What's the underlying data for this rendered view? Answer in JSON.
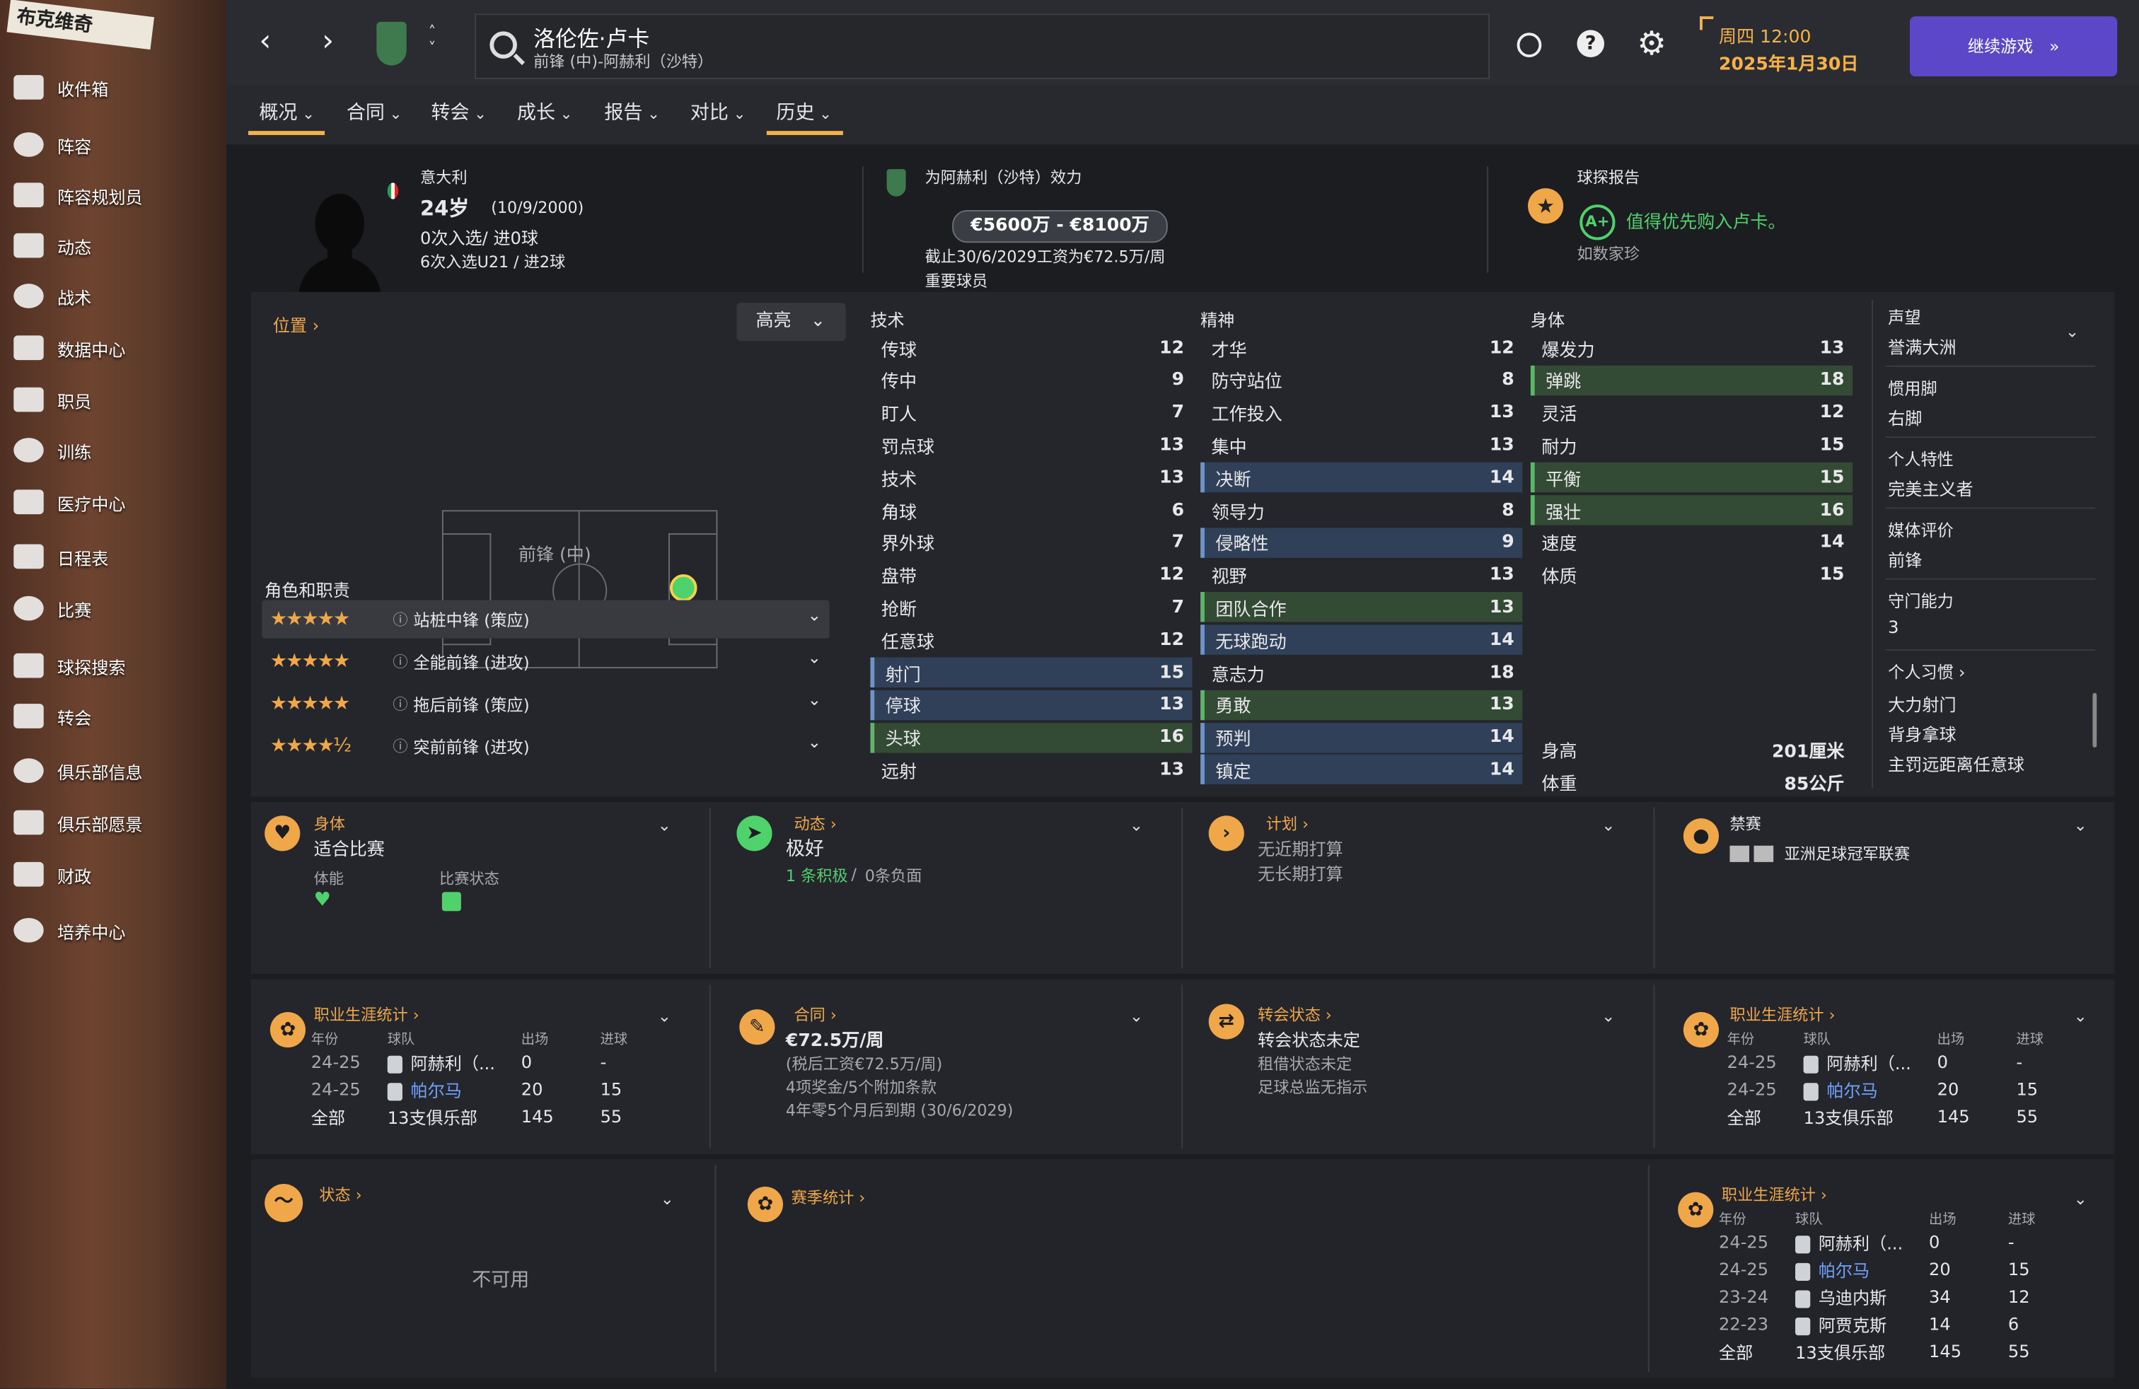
{
  "sidebar": {
    "brand": "布克维奇",
    "items": [
      "收件箱",
      "阵容",
      "阵容规划员",
      "动态",
      "战术",
      "数据中心",
      "职员",
      "训练",
      "医疗中心",
      "日程表",
      "比赛",
      "球探搜索",
      "转会",
      "俱乐部信息",
      "俱乐部愿景",
      "财政",
      "培养中心"
    ]
  },
  "header": {
    "player_name": "洛伦佐·卢卡",
    "player_sub": "前锋 (中)-阿赫利（沙特）",
    "help": "?",
    "day_time": "周四 12:00",
    "date": "2025年1月30日",
    "continue_label": "继续游戏"
  },
  "tabs": [
    "概况",
    "合同",
    "转会",
    "成长",
    "报告",
    "对比",
    "历史"
  ],
  "overview": {
    "nationality": "意大利",
    "age": "24岁",
    "dob": "(10/9/2000)",
    "caps": "0次入选/ 进0球",
    "u21": "6次入选U21 / 进2球",
    "club_line": "为阿赫利（沙特）效力",
    "value": "€5600万 - €8100万",
    "contract": "截止30/6/2029工资为€72.5万/周",
    "status": "重要球员",
    "scout_title": "球探报告",
    "grade": "A+",
    "scout_text": "值得优先购入卢卡。",
    "scout_name": "如数家珍"
  },
  "position_panel": {
    "title": "位置",
    "dropdown": "高亮",
    "position_label": "前锋 (中)",
    "roles_title": "角色和职责",
    "roles": [
      {
        "stars": "★★★★★",
        "name": "站桩中锋 (策应)"
      },
      {
        "stars": "★★★★★",
        "name": "全能前锋 (进攻)"
      },
      {
        "stars": "★★★★★",
        "name": "拖后前锋 (策应)"
      },
      {
        "stars": "★★★★½",
        "name": "突前前锋 (进攻)"
      }
    ]
  },
  "attributes": {
    "technical_title": "技术",
    "mental_title": "精神",
    "physical_title": "身体",
    "technical": [
      {
        "name": "传球",
        "value": "12",
        "hl": ""
      },
      {
        "name": "传中",
        "value": "9",
        "hl": ""
      },
      {
        "name": "盯人",
        "value": "7",
        "hl": ""
      },
      {
        "name": "罚点球",
        "value": "13",
        "hl": ""
      },
      {
        "name": "技术",
        "value": "13",
        "hl": ""
      },
      {
        "name": "角球",
        "value": "6",
        "hl": ""
      },
      {
        "name": "界外球",
        "value": "7",
        "hl": ""
      },
      {
        "name": "盘带",
        "value": "12",
        "hl": ""
      },
      {
        "name": "抢断",
        "value": "7",
        "hl": ""
      },
      {
        "name": "任意球",
        "value": "12",
        "hl": ""
      },
      {
        "name": "射门",
        "value": "15",
        "hl": "blue"
      },
      {
        "name": "停球",
        "value": "13",
        "hl": "blue"
      },
      {
        "name": "头球",
        "value": "16",
        "hl": "green"
      },
      {
        "name": "远射",
        "value": "13",
        "hl": ""
      }
    ],
    "mental": [
      {
        "name": "才华",
        "value": "12",
        "hl": ""
      },
      {
        "name": "防守站位",
        "value": "8",
        "hl": ""
      },
      {
        "name": "工作投入",
        "value": "13",
        "hl": ""
      },
      {
        "name": "集中",
        "value": "13",
        "hl": ""
      },
      {
        "name": "决断",
        "value": "14",
        "hl": "blue"
      },
      {
        "name": "领导力",
        "value": "8",
        "hl": ""
      },
      {
        "name": "侵略性",
        "value": "9",
        "hl": "blue"
      },
      {
        "name": "视野",
        "value": "13",
        "hl": ""
      },
      {
        "name": "团队合作",
        "value": "13",
        "hl": "green"
      },
      {
        "name": "无球跑动",
        "value": "14",
        "hl": "blue"
      },
      {
        "name": "意志力",
        "value": "18",
        "hl": ""
      },
      {
        "name": "勇敢",
        "value": "13",
        "hl": "green"
      },
      {
        "name": "预判",
        "value": "14",
        "hl": "blue"
      },
      {
        "name": "镇定",
        "value": "14",
        "hl": "blue"
      }
    ],
    "physical": [
      {
        "name": "爆发力",
        "value": "13",
        "hl": ""
      },
      {
        "name": "弹跳",
        "value": "18",
        "hl": "green"
      },
      {
        "name": "灵活",
        "value": "12",
        "hl": ""
      },
      {
        "name": "耐力",
        "value": "15",
        "hl": ""
      },
      {
        "name": "平衡",
        "value": "15",
        "hl": "green"
      },
      {
        "name": "强壮",
        "value": "16",
        "hl": "green"
      },
      {
        "name": "速度",
        "value": "14",
        "hl": ""
      },
      {
        "name": "体质",
        "value": "15",
        "hl": ""
      }
    ],
    "height_label": "身高",
    "height": "201厘米",
    "weight_label": "体重",
    "weight": "85公斤"
  },
  "info_side": [
    {
      "label": "声望",
      "value": "誉满大洲"
    },
    {
      "label": "惯用脚",
      "value": "右脚"
    },
    {
      "label": "个人特性",
      "value": "完美主义者"
    },
    {
      "label": "媒体评价",
      "value": "前锋"
    },
    {
      "label": "守门能力",
      "value": "3"
    }
  ],
  "habits": {
    "title": "个人习惯",
    "items": [
      "大力射门",
      "背身拿球",
      "主罚远距离任意球"
    ]
  },
  "cards1": {
    "fitness_title": "身体",
    "fitness_value": "适合比赛",
    "stamina_label": "体能",
    "match_label": "比赛状态",
    "dyn_title": "动态",
    "dyn_value": "极好",
    "dyn_positive": "1 条积极",
    "dyn_sep": "/",
    "dyn_negative": "0条负面",
    "plan_title": "计划",
    "plan_short": "无近期打算",
    "plan_long": "无长期打算",
    "ban_title": "禁赛",
    "ban_text": "亚洲足球冠军联赛"
  },
  "career": {
    "title": "职业生涯统计",
    "head": [
      "年份",
      "球队",
      "出场",
      "进球"
    ],
    "rows": [
      [
        "24-25",
        "阿赫利（...",
        "0",
        "-"
      ],
      [
        "24-25",
        "帕尔马",
        "20",
        "15"
      ]
    ],
    "rows_long": [
      [
        "24-25",
        "阿赫利（...",
        "0",
        "-"
      ],
      [
        "24-25",
        "帕尔马",
        "20",
        "15"
      ],
      [
        "23-24",
        "乌迪内斯",
        "34",
        "12"
      ],
      [
        "22-23",
        "阿贾克斯",
        "14",
        "6"
      ]
    ],
    "total": [
      "全部",
      "13支俱乐部",
      "145",
      "55"
    ]
  },
  "contract_card": {
    "title": "合同",
    "wage": "€72.5万/周",
    "pre_tax": "(税后工资€72.5万/周)",
    "bonus": "4项奖金/5个附加条款",
    "expiry": "4年零5个月后到期 (30/6/2029)"
  },
  "transfer_card": {
    "title": "转会状态",
    "value": "转会状态未定",
    "loan": "租借状态未定",
    "director": "足球总监无指示"
  },
  "form_card": {
    "title": "状态",
    "value": "不可用"
  },
  "season_card": {
    "title": "赛季统计"
  }
}
